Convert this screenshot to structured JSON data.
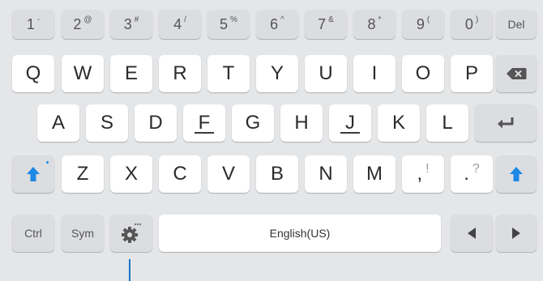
{
  "numbers": [
    {
      "main": "1",
      "sup": "-"
    },
    {
      "main": "2",
      "sup": "@"
    },
    {
      "main": "3",
      "sup": "#"
    },
    {
      "main": "4",
      "sup": "/"
    },
    {
      "main": "5",
      "sup": "%"
    },
    {
      "main": "6",
      "sup": "^"
    },
    {
      "main": "7",
      "sup": "&"
    },
    {
      "main": "8",
      "sup": "*"
    },
    {
      "main": "9",
      "sup": "("
    },
    {
      "main": "0",
      "sup": ")"
    }
  ],
  "del_label": "Del",
  "row1": [
    "Q",
    "W",
    "E",
    "R",
    "T",
    "Y",
    "U",
    "I",
    "O",
    "P"
  ],
  "row2": [
    "A",
    "S",
    "D",
    "F",
    "G",
    "H",
    "J",
    "K",
    "L"
  ],
  "row3": [
    "Z",
    "X",
    "C",
    "V",
    "B",
    "N",
    "M"
  ],
  "punct": [
    {
      "main": ",",
      "sup": "!"
    },
    {
      "main": ".",
      "sup": "?"
    }
  ],
  "bottom": {
    "ctrl": "Ctrl",
    "sym": "Sym",
    "space": "English(US)"
  },
  "icons": {
    "backspace": "backspace-icon",
    "enter": "enter-icon",
    "shift": "shift-icon",
    "settings": "settings-icon",
    "left": "arrow-left-icon",
    "right": "arrow-right-icon"
  },
  "colors": {
    "background": "#e5e6e8",
    "key": "#ffffff",
    "gray_key": "#dcdde0",
    "accent": "#1e88e5"
  }
}
